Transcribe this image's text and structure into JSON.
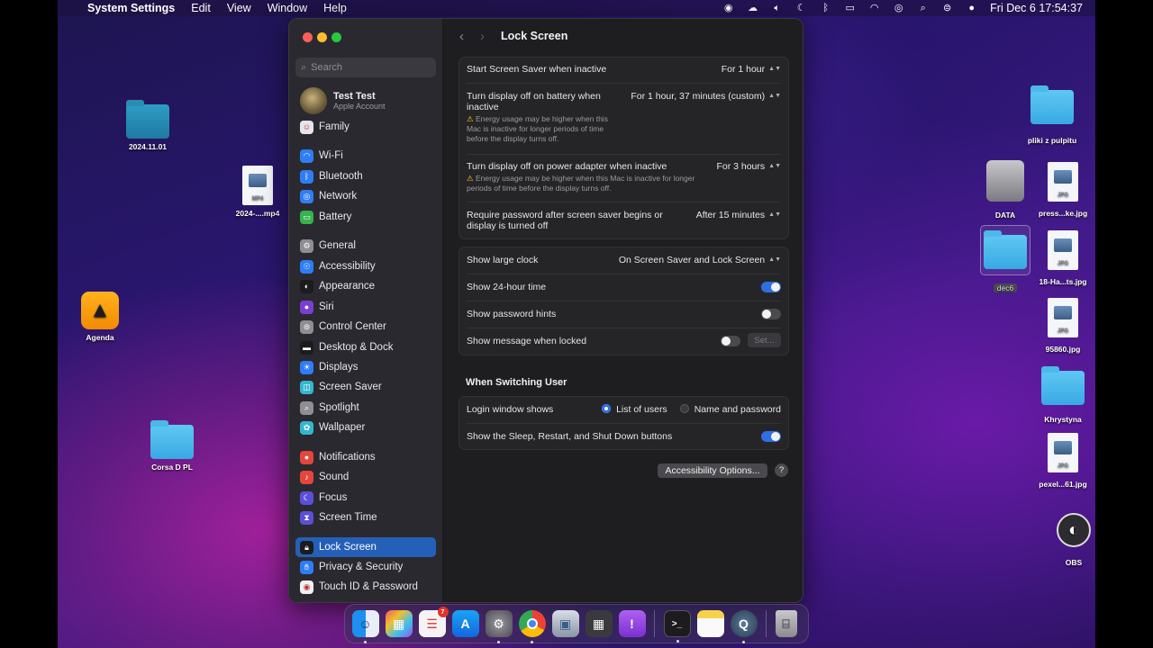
{
  "menubar": {
    "app": "System Settings",
    "menus": [
      "Edit",
      "View",
      "Window",
      "Help"
    ],
    "datetime": "Fri Dec 6  17:54:37"
  },
  "desktop": {
    "left": [
      {
        "label": "2024.11.01",
        "kind": "folder"
      },
      {
        "label": "2024-....mp4",
        "kind": "video",
        "tag": "MP4"
      },
      {
        "label": "Agenda",
        "kind": "app"
      },
      {
        "label": "Corsa D PL",
        "kind": "folder"
      }
    ],
    "right": [
      {
        "label": "pliki z pulpitu",
        "kind": "folder"
      },
      {
        "label": "DATA",
        "kind": "drive"
      },
      {
        "label": "press...ke.jpg",
        "kind": "image",
        "tag": "JPG"
      },
      {
        "label": "dec6",
        "kind": "folder"
      },
      {
        "label": "18-Ha...ts.jpg",
        "kind": "image",
        "tag": "JPG"
      },
      {
        "label": "95860.jpg",
        "kind": "image",
        "tag": "JPG"
      },
      {
        "label": "Khrystyna",
        "kind": "folder"
      },
      {
        "label": "pexel...61.jpg",
        "kind": "image",
        "tag": "JPG"
      },
      {
        "label": "OBS",
        "kind": "app"
      }
    ]
  },
  "sidebar": {
    "search_placeholder": "Search",
    "account": {
      "name": "Test Test",
      "subtitle": "Apple Account"
    },
    "items": [
      {
        "label": "Family",
        "icon": "family-icon",
        "color": "#e6e6ea"
      },
      {
        "label": "Wi-Fi",
        "icon": "wifi-icon",
        "color": "#2f7df6"
      },
      {
        "label": "Bluetooth",
        "icon": "bluetooth-icon",
        "color": "#2f7df6"
      },
      {
        "label": "Network",
        "icon": "globe-icon",
        "color": "#2f7df6"
      },
      {
        "label": "Battery",
        "icon": "battery-icon",
        "color": "#36b34a"
      },
      {
        "label": "General",
        "icon": "gear-icon",
        "color": "#8e8e93"
      },
      {
        "label": "Accessibility",
        "icon": "accessibility-icon",
        "color": "#2f7df6"
      },
      {
        "label": "Appearance",
        "icon": "appearance-icon",
        "color": "#1c1c1e"
      },
      {
        "label": "Siri",
        "icon": "siri-icon",
        "color": "#7a3fd0"
      },
      {
        "label": "Control Center",
        "icon": "control-center-icon",
        "color": "#8e8e93"
      },
      {
        "label": "Desktop & Dock",
        "icon": "dock-icon",
        "color": "#1c1c1e"
      },
      {
        "label": "Displays",
        "icon": "displays-icon",
        "color": "#2f7df6"
      },
      {
        "label": "Screen Saver",
        "icon": "screen-saver-icon",
        "color": "#35b6d0"
      },
      {
        "label": "Spotlight",
        "icon": "spotlight-icon",
        "color": "#8e8e93"
      },
      {
        "label": "Wallpaper",
        "icon": "wallpaper-icon",
        "color": "#35b6d0"
      },
      {
        "label": "Notifications",
        "icon": "notifications-icon",
        "color": "#e5453a"
      },
      {
        "label": "Sound",
        "icon": "sound-icon",
        "color": "#e5453a"
      },
      {
        "label": "Focus",
        "icon": "focus-icon",
        "color": "#5b4fd8"
      },
      {
        "label": "Screen Time",
        "icon": "screen-time-icon",
        "color": "#5b4fd8"
      },
      {
        "label": "Lock Screen",
        "icon": "lock-icon",
        "color": "#1c1c1e",
        "active": true
      },
      {
        "label": "Privacy & Security",
        "icon": "hand-icon",
        "color": "#2f7df6"
      },
      {
        "label": "Touch ID & Password",
        "icon": "fingerprint-icon",
        "color": "#f0f0f0"
      }
    ]
  },
  "page": {
    "title": "Lock Screen",
    "rows": {
      "screen_saver": {
        "label": "Start Screen Saver when inactive",
        "value": "For 1 hour"
      },
      "battery": {
        "label": "Turn display off on battery when inactive",
        "value": "For 1 hour, 37 minutes (custom)",
        "warning": "Energy usage may be higher when this Mac is inactive for longer periods of time before the display turns off."
      },
      "adapter": {
        "label": "Turn display off on power adapter when inactive",
        "value": "For 3 hours",
        "warning": "Energy usage may be higher when this Mac is inactive for longer periods of time before the display turns off."
      },
      "password": {
        "label": "Require password after screen saver begins or display is turned off",
        "value": "After 15 minutes"
      },
      "large_clock": {
        "label": "Show large clock",
        "value": "On Screen Saver and Lock Screen"
      },
      "24h": {
        "label": "Show 24-hour time",
        "on": true
      },
      "hints": {
        "label": "Show password hints",
        "on": false
      },
      "message": {
        "label": "Show message when locked",
        "on": false,
        "button": "Set..."
      }
    },
    "switching": {
      "heading": "When Switching User",
      "login_label": "Login window shows",
      "option_list": "List of users",
      "option_name": "Name and password",
      "selected": "List of users",
      "shutdown_label": "Show the Sleep, Restart, and Shut Down buttons",
      "shutdown_on": true
    },
    "accessibility_button": "Accessibility Options...",
    "help_button": "?"
  },
  "dock": {
    "reminders_badge": "7",
    "apps": [
      "Finder",
      "Launchpad",
      "Reminders",
      "App Store",
      "System Settings",
      "Chrome",
      "Preview",
      "Calculator",
      "Feedback Assistant",
      "Terminal",
      "Notes",
      "QuickTime Player",
      "Trash"
    ]
  }
}
